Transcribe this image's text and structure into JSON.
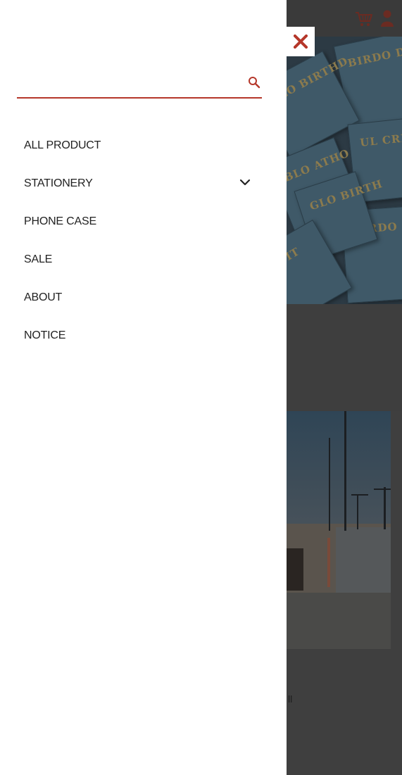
{
  "background": {
    "hero_cards": [
      {
        "text": "BIRDO DAY"
      },
      {
        "text": "GLO BIRTHD"
      },
      {
        "text": "UL CRIAN"
      },
      {
        "text": "BLO ATHO"
      },
      {
        "text": "BIRDO DAY"
      },
      {
        "text": "GLO BIRTH"
      },
      {
        "text": "OBIT"
      }
    ],
    "partial_text": "ll"
  },
  "header": {
    "cart_icon": "cart-icon",
    "user_icon": "user-icon"
  },
  "drawer": {
    "close_icon": "close-icon",
    "search": {
      "placeholder": "",
      "value": "",
      "icon": "search-icon"
    },
    "menu": [
      {
        "label": "ALL PRODUCT",
        "has_submenu": false
      },
      {
        "label": "STATIONERY",
        "has_submenu": true
      },
      {
        "label": "PHONE CASE",
        "has_submenu": false
      },
      {
        "label": "SALE",
        "has_submenu": false
      },
      {
        "label": "ABOUT",
        "has_submenu": false
      },
      {
        "label": "NOTICE",
        "has_submenu": false
      }
    ]
  },
  "colors": {
    "accent": "#b5372a",
    "overlay": "#3f3f3f",
    "drawer_bg": "#ffffff",
    "text": "#222222"
  }
}
